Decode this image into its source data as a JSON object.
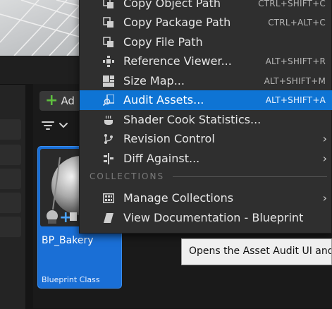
{
  "toolbar": {
    "add_label": "Ad"
  },
  "asset": {
    "name": "BP_Bakery",
    "type": "Blueprint Class"
  },
  "context_menu": {
    "items": [
      {
        "label": "Copy Object Path",
        "shortcut": "CTRL+SHIFT+C",
        "icon": "copy-object-path-icon"
      },
      {
        "label": "Copy Package Path",
        "shortcut": "CTRL+ALT+C",
        "icon": "copy-package-path-icon"
      },
      {
        "label": "Copy File Path",
        "shortcut": "",
        "icon": "copy-file-path-icon"
      },
      {
        "label": "Reference Viewer...",
        "shortcut": "ALT+SHIFT+R",
        "icon": "reference-viewer-icon"
      },
      {
        "label": "Size Map...",
        "shortcut": "ALT+SHIFT+M",
        "icon": "size-map-icon"
      },
      {
        "label": "Audit Assets...",
        "shortcut": "ALT+SHIFT+A",
        "icon": "audit-assets-icon"
      },
      {
        "label": "Shader Cook Statistics...",
        "shortcut": "",
        "icon": "shader-cook-icon"
      },
      {
        "label": "Revision Control",
        "shortcut": "",
        "icon": "revision-control-icon"
      },
      {
        "label": "Diff Against...",
        "shortcut": "",
        "icon": "diff-against-icon"
      }
    ],
    "collections_header": "COLLECTIONS",
    "collection_items": [
      {
        "label": "Manage Collections",
        "icon": "manage-collections-icon"
      },
      {
        "label": "View Documentation - Blueprint",
        "icon": "view-documentation-icon"
      }
    ]
  },
  "tooltip": {
    "text": "Opens the Asset Audit UI and"
  },
  "colors": {
    "highlight": "#0e74d4",
    "menu_bg": "#2f2f2f",
    "asset_tile": "#1a6fd6",
    "add_plus": "#5fbf3f"
  }
}
